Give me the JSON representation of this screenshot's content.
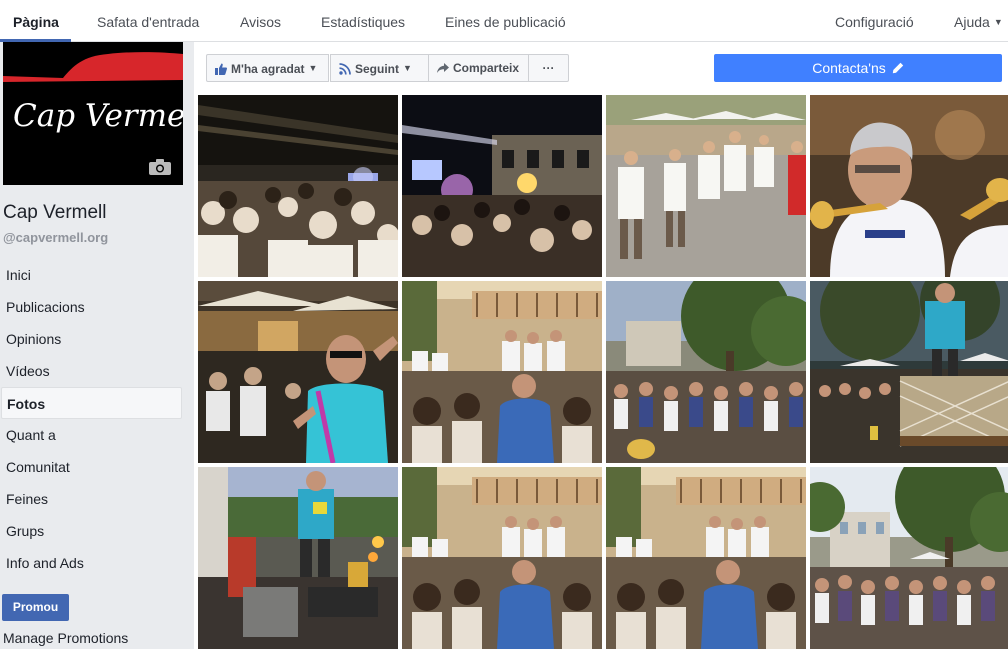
{
  "topnav": {
    "tabs": [
      {
        "label": "Pàgina",
        "active": true
      },
      {
        "label": "Safata d'entrada"
      },
      {
        "label": "Avisos"
      },
      {
        "label": "Estadístiques"
      },
      {
        "label": "Eines de publicació"
      }
    ],
    "settings": "Configuració",
    "help": "Ajuda"
  },
  "sidebar": {
    "cover_text": "Cap Vermell",
    "page_name": "Cap Vermell",
    "handle": "@capvermell.org",
    "items": [
      {
        "label": "Inici"
      },
      {
        "label": "Publicacions"
      },
      {
        "label": "Opinions"
      },
      {
        "label": "Vídeos"
      },
      {
        "label": "Fotos",
        "active": true
      },
      {
        "label": "Quant a"
      },
      {
        "label": "Comunitat"
      },
      {
        "label": "Feines"
      },
      {
        "label": "Grups"
      },
      {
        "label": "Info and Ads"
      }
    ],
    "promote": "Promou",
    "manage": "Manage Promotions"
  },
  "actions": {
    "like": "M'ha agradat",
    "follow": "Seguint",
    "share": "Comparteix",
    "more": "···",
    "contact": "Contacta'ns"
  },
  "colors": {
    "brand": "#4267b2",
    "contact_button": "#4080ff",
    "cover_red": "#d7262b"
  },
  "photos": [
    {
      "scene": "night-concert-crowd"
    },
    {
      "scene": "night-stage-lights"
    },
    {
      "scene": "square-white-umbrellas"
    },
    {
      "scene": "trumpet-player"
    },
    {
      "scene": "terrace-dancer-blue-shirt"
    },
    {
      "scene": "band-on-balcony-crowd"
    },
    {
      "scene": "tree-square-crowd"
    },
    {
      "scene": "dusk-stage-blue-shirt"
    },
    {
      "scene": "speaker-on-truck"
    },
    {
      "scene": "band-on-balcony-crowd"
    },
    {
      "scene": "band-on-balcony-crowd"
    },
    {
      "scene": "tree-square-crowd-day"
    }
  ]
}
